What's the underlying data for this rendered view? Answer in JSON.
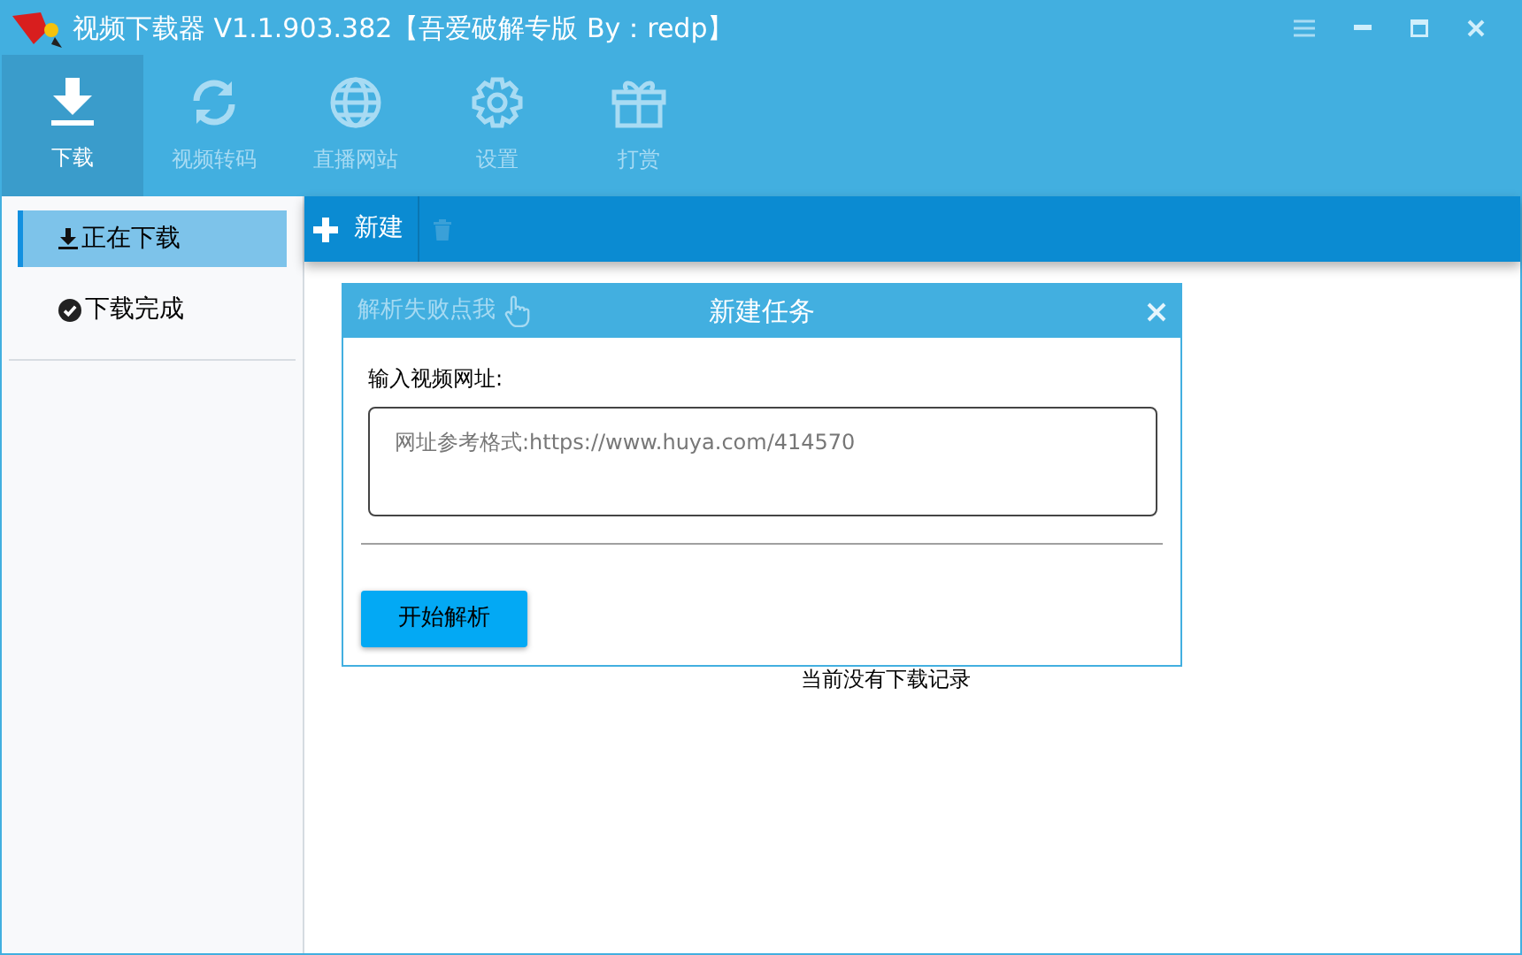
{
  "window": {
    "title": "视频下载器 V1.1.903.382【吾爱破解专版  By：redp】"
  },
  "nav_tabs": [
    {
      "label": "下载",
      "kind": "download",
      "selected": true
    },
    {
      "label": "视频转码",
      "kind": "convert",
      "selected": false
    },
    {
      "label": "直播网站",
      "kind": "globe",
      "selected": false
    },
    {
      "label": "设置",
      "kind": "gear",
      "selected": false
    },
    {
      "label": "打赏",
      "kind": "gift",
      "selected": false
    }
  ],
  "sidebar": {
    "items": [
      {
        "label": "正在下载",
        "kind": "download",
        "selected": true
      },
      {
        "label": "下载完成",
        "kind": "check",
        "selected": false
      }
    ]
  },
  "toolbar": {
    "new_button": "新建",
    "delete_disabled": true
  },
  "empty_message": "当前没有下载记录",
  "dialog": {
    "help_link": "解析失败点我",
    "title": "新建任务",
    "field_label": "输入视频网址:",
    "placeholder": "网址参考格式:https://www.huya.com/414570",
    "submit_button": "开始解析"
  }
}
